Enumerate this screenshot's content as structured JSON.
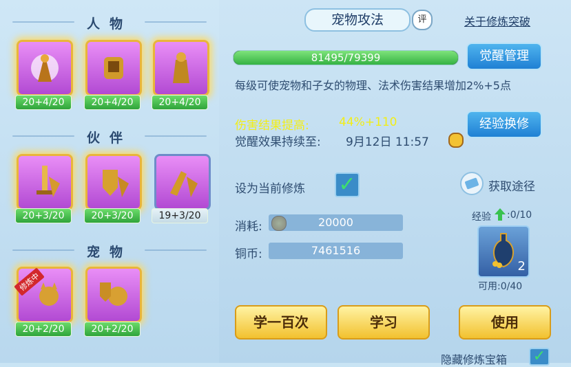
{
  "left": {
    "sections": [
      {
        "title": "人物",
        "slots": [
          {
            "level": "20+4/20",
            "highlight": true
          },
          {
            "level": "20+4/20",
            "highlight": true
          },
          {
            "level": "20+4/20",
            "highlight": true
          }
        ]
      },
      {
        "title": "伙伴",
        "slots": [
          {
            "level": "20+3/20",
            "highlight": true
          },
          {
            "level": "20+3/20",
            "highlight": true
          },
          {
            "level": "19+3/20",
            "highlight": false
          }
        ]
      },
      {
        "title": "宠物",
        "slots": [
          {
            "level": "20+2/20",
            "highlight": true,
            "badge": "修炼中"
          },
          {
            "level": "20+2/20",
            "highlight": true
          }
        ]
      }
    ]
  },
  "header": {
    "title": "宠物攻法",
    "rate_label": "评",
    "link": "关于修炼突破"
  },
  "progress": {
    "text": "81495/79399",
    "fraction": 1.0
  },
  "buttons": {
    "awaken": "觉醒管理",
    "exchange": "经验换修",
    "learn100": "学一百次",
    "learn": "学习",
    "use": "使用"
  },
  "description": "每级可使宠物和子女的物理、法术伤害结果增加2%+5点",
  "bonus": {
    "label": "伤害结果提高:",
    "value": "44%+110"
  },
  "duration": {
    "label": "觉醒效果持续至:",
    "value": "9月12日 11:57"
  },
  "current": {
    "label": "设为当前修炼",
    "checked": true
  },
  "obtain": "获取途径",
  "cost": {
    "label": "消耗:",
    "value": "20000"
  },
  "copper": {
    "label": "铜币:",
    "value": "7461516"
  },
  "item": {
    "exp_label": "经验",
    "exp_value": ":0/10",
    "count": "2",
    "usable": "可用:0/40"
  },
  "hide": {
    "label": "隐藏修炼宝箱"
  },
  "colors": {
    "accent": "#1f80d4",
    "gold": "#f2c12f",
    "green": "#35b243",
    "yellow_text": "#f2ee17"
  }
}
